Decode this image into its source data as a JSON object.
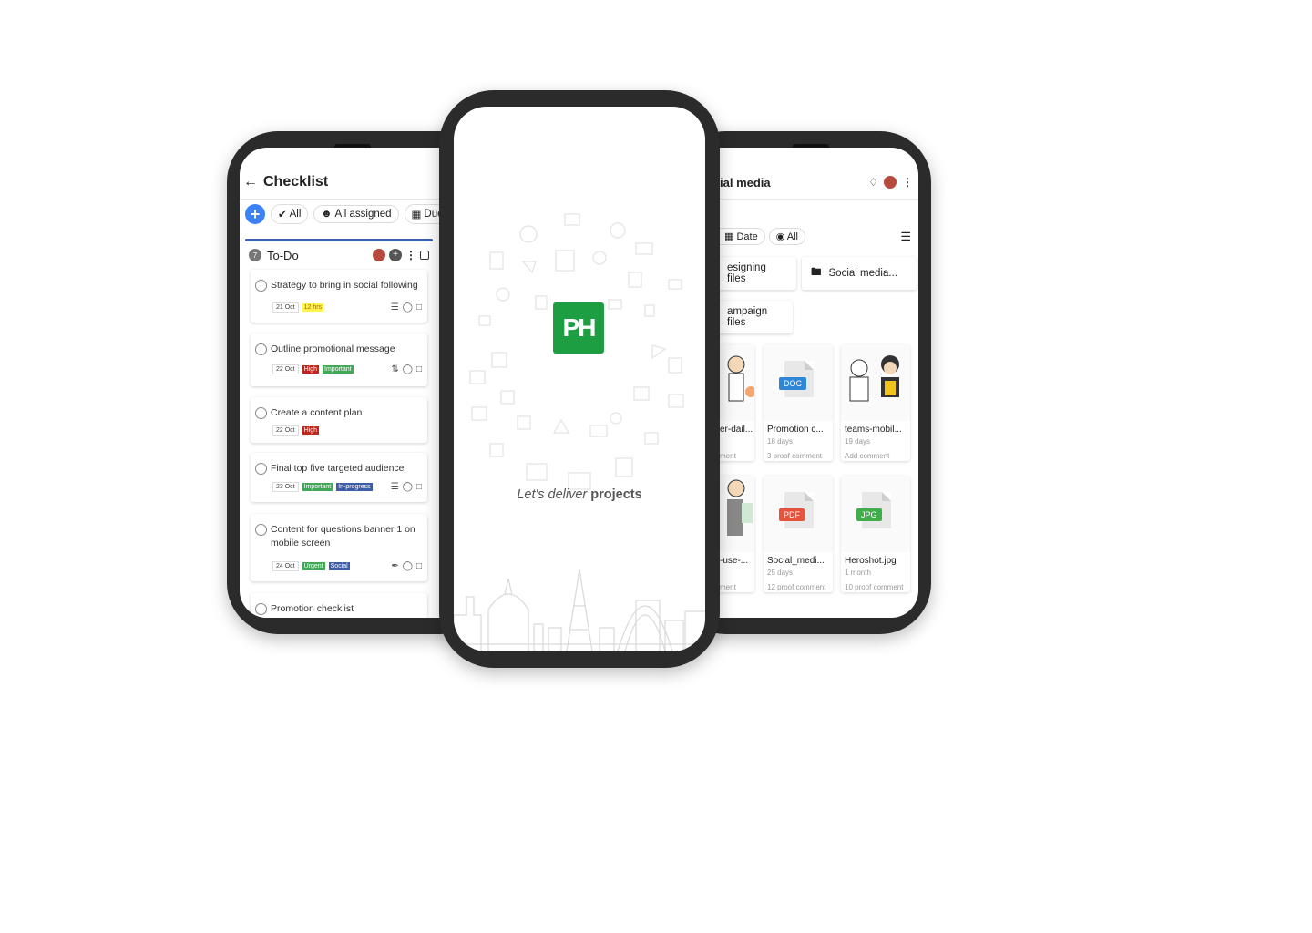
{
  "checklist": {
    "title": "Checklist",
    "filters": [
      "All",
      "All assigned",
      "Due t"
    ],
    "section": {
      "count": "7",
      "title": "To-Do"
    },
    "tasks": [
      {
        "name": "Strategy to bring in social following",
        "date": "21 Oct",
        "tags": [
          "12 hrs"
        ]
      },
      {
        "name": "Outline promotional message",
        "date": "22 Oct",
        "tags": [
          "High",
          "Important"
        ]
      },
      {
        "name": "Create a content plan",
        "date": "22 Oct",
        "tags": [
          "High"
        ]
      },
      {
        "name": "Final top five targeted audience",
        "date": "23 Oct",
        "tags": [
          "Important",
          "In-progress"
        ]
      },
      {
        "name": "Content for questions banner 1 on mobile screen",
        "date": "24 Oct",
        "tags": [
          "Urgent",
          "Social"
        ]
      },
      {
        "name": "Promotion checklist"
      }
    ]
  },
  "splash": {
    "logo": "PH",
    "tagline_italic": "Let's deliver",
    "tagline_bold": "projects"
  },
  "files": {
    "title": "ial media",
    "filters": [
      "Date",
      "All"
    ],
    "folders": [
      "esigning files",
      "Social media...",
      "ampaign files"
    ],
    "cards": [
      {
        "name": "er-dail...",
        "sub": "",
        "comments": "ment"
      },
      {
        "name": "Promotion c...",
        "sub": "18 days",
        "comments": "3 proof comment",
        "type": "DOC"
      },
      {
        "name": "teams-mobil...",
        "sub": "19 days",
        "comments": "Add comment"
      },
      {
        "name": "-use-...",
        "sub": "",
        "comments": "ment"
      },
      {
        "name": "Social_medi...",
        "sub": "25 days",
        "comments": "12 proof comment",
        "type": "PDF"
      },
      {
        "name": "Heroshot.jpg",
        "sub": "1 month",
        "comments": "10 proof comment",
        "type": "JPG"
      }
    ]
  },
  "colors": {
    "accent_blue": "#3b82f6",
    "brand_green": "#1e9e43",
    "high_red": "#c0271d",
    "important_green": "#41a857",
    "doc_blue": "#2f86d6",
    "pdf_red": "#e5533d",
    "jpg_green": "#3fae49"
  }
}
